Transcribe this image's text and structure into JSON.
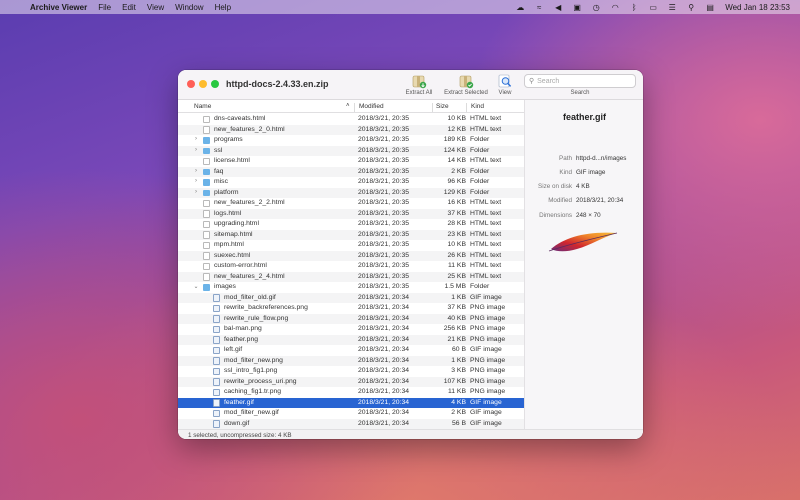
{
  "menubar": {
    "app": "Archive Viewer",
    "items": [
      "File",
      "Edit",
      "View",
      "Window",
      "Help"
    ],
    "clock": "Wed Jan 18  23:53"
  },
  "window": {
    "title": "httpd-docs-2.4.33.en.zip",
    "toolbar": {
      "extract_all": "Extract All",
      "extract_selected": "Extract Selected",
      "view": "View",
      "search_placeholder": "Search",
      "search_caption": "Search"
    },
    "columns": {
      "name": "Name",
      "modified": "Modified",
      "size": "Size",
      "kind": "Kind"
    },
    "rows": [
      {
        "name": "dns-caveats.html",
        "modified": "2018/3/21, 20:35",
        "size": "10 KB",
        "kind": "HTML text",
        "type": "doc",
        "depth": 0,
        "expander": ""
      },
      {
        "name": "new_features_2_0.html",
        "modified": "2018/3/21, 20:35",
        "size": "12 KB",
        "kind": "HTML text",
        "type": "doc",
        "depth": 0,
        "expander": ""
      },
      {
        "name": "programs",
        "modified": "2018/3/21, 20:35",
        "size": "189 KB",
        "kind": "Folder",
        "type": "folder",
        "depth": 0,
        "expander": "›"
      },
      {
        "name": "ssl",
        "modified": "2018/3/21, 20:35",
        "size": "124 KB",
        "kind": "Folder",
        "type": "folder",
        "depth": 0,
        "expander": "›"
      },
      {
        "name": "license.html",
        "modified": "2018/3/21, 20:35",
        "size": "14 KB",
        "kind": "HTML text",
        "type": "doc",
        "depth": 0,
        "expander": ""
      },
      {
        "name": "faq",
        "modified": "2018/3/21, 20:35",
        "size": "2 KB",
        "kind": "Folder",
        "type": "folder",
        "depth": 0,
        "expander": "›"
      },
      {
        "name": "misc",
        "modified": "2018/3/21, 20:35",
        "size": "96 KB",
        "kind": "Folder",
        "type": "folder",
        "depth": 0,
        "expander": "›"
      },
      {
        "name": "platform",
        "modified": "2018/3/21, 20:35",
        "size": "129 KB",
        "kind": "Folder",
        "type": "folder",
        "depth": 0,
        "expander": "›"
      },
      {
        "name": "new_features_2_2.html",
        "modified": "2018/3/21, 20:35",
        "size": "16 KB",
        "kind": "HTML text",
        "type": "doc",
        "depth": 0,
        "expander": ""
      },
      {
        "name": "logs.html",
        "modified": "2018/3/21, 20:35",
        "size": "37 KB",
        "kind": "HTML text",
        "type": "doc",
        "depth": 0,
        "expander": ""
      },
      {
        "name": "upgrading.html",
        "modified": "2018/3/21, 20:35",
        "size": "28 KB",
        "kind": "HTML text",
        "type": "doc",
        "depth": 0,
        "expander": ""
      },
      {
        "name": "sitemap.html",
        "modified": "2018/3/21, 20:35",
        "size": "23 KB",
        "kind": "HTML text",
        "type": "doc",
        "depth": 0,
        "expander": ""
      },
      {
        "name": "mpm.html",
        "modified": "2018/3/21, 20:35",
        "size": "10 KB",
        "kind": "HTML text",
        "type": "doc",
        "depth": 0,
        "expander": ""
      },
      {
        "name": "suexec.html",
        "modified": "2018/3/21, 20:35",
        "size": "26 KB",
        "kind": "HTML text",
        "type": "doc",
        "depth": 0,
        "expander": ""
      },
      {
        "name": "custom-error.html",
        "modified": "2018/3/21, 20:35",
        "size": "11 KB",
        "kind": "HTML text",
        "type": "doc",
        "depth": 0,
        "expander": ""
      },
      {
        "name": "new_features_2_4.html",
        "modified": "2018/3/21, 20:35",
        "size": "25 KB",
        "kind": "HTML text",
        "type": "doc",
        "depth": 0,
        "expander": ""
      },
      {
        "name": "images",
        "modified": "2018/3/21, 20:35",
        "size": "1.5 MB",
        "kind": "Folder",
        "type": "folder",
        "depth": 0,
        "expander": "⌄"
      },
      {
        "name": "mod_filter_old.gif",
        "modified": "2018/3/21, 20:34",
        "size": "1 KB",
        "kind": "GIF image",
        "type": "img",
        "depth": 1,
        "expander": ""
      },
      {
        "name": "rewrite_backreferences.png",
        "modified": "2018/3/21, 20:34",
        "size": "37 KB",
        "kind": "PNG image",
        "type": "img",
        "depth": 1,
        "expander": ""
      },
      {
        "name": "rewrite_rule_flow.png",
        "modified": "2018/3/21, 20:34",
        "size": "40 KB",
        "kind": "PNG image",
        "type": "img",
        "depth": 1,
        "expander": ""
      },
      {
        "name": "bal-man.png",
        "modified": "2018/3/21, 20:34",
        "size": "256 KB",
        "kind": "PNG image",
        "type": "img",
        "depth": 1,
        "expander": ""
      },
      {
        "name": "feather.png",
        "modified": "2018/3/21, 20:34",
        "size": "21 KB",
        "kind": "PNG image",
        "type": "img",
        "depth": 1,
        "expander": ""
      },
      {
        "name": "left.gif",
        "modified": "2018/3/21, 20:34",
        "size": "60 B",
        "kind": "GIF image",
        "type": "img",
        "depth": 1,
        "expander": ""
      },
      {
        "name": "mod_filter_new.png",
        "modified": "2018/3/21, 20:34",
        "size": "1 KB",
        "kind": "PNG image",
        "type": "img",
        "depth": 1,
        "expander": ""
      },
      {
        "name": "ssl_intro_fig1.png",
        "modified": "2018/3/21, 20:34",
        "size": "3 KB",
        "kind": "PNG image",
        "type": "img",
        "depth": 1,
        "expander": ""
      },
      {
        "name": "rewrite_process_uri.png",
        "modified": "2018/3/21, 20:34",
        "size": "107 KB",
        "kind": "PNG image",
        "type": "img",
        "depth": 1,
        "expander": ""
      },
      {
        "name": "caching_fig1.tr.png",
        "modified": "2018/3/21, 20:34",
        "size": "11 KB",
        "kind": "PNG image",
        "type": "img",
        "depth": 1,
        "expander": ""
      },
      {
        "name": "feather.gif",
        "modified": "2018/3/21, 20:34",
        "size": "4 KB",
        "kind": "GIF image",
        "type": "img",
        "depth": 1,
        "expander": "",
        "selected": true
      },
      {
        "name": "mod_filter_new.gif",
        "modified": "2018/3/21, 20:34",
        "size": "2 KB",
        "kind": "GIF image",
        "type": "img",
        "depth": 1,
        "expander": ""
      },
      {
        "name": "down.gif",
        "modified": "2018/3/21, 20:34",
        "size": "56 B",
        "kind": "GIF image",
        "type": "img",
        "depth": 1,
        "expander": ""
      }
    ],
    "inspector": {
      "title": "feather.gif",
      "path_label": "Path",
      "path_value": "httpd-d...n/images",
      "kind_label": "Kind",
      "kind_value": "GIF image",
      "size_label": "Size on disk",
      "size_value": "4 KB",
      "modified_label": "Modified",
      "modified_value": "2018/3/21, 20:34",
      "dimensions_label": "Dimensions",
      "dimensions_value": "248 × 70"
    },
    "status": "1 selected, uncompressed size: 4 KB"
  },
  "colors": {
    "selection": "#2864d2",
    "folder": "#6bb3e8",
    "close": "#ff5f57",
    "minimize": "#febc2e",
    "maximize": "#28c840"
  }
}
